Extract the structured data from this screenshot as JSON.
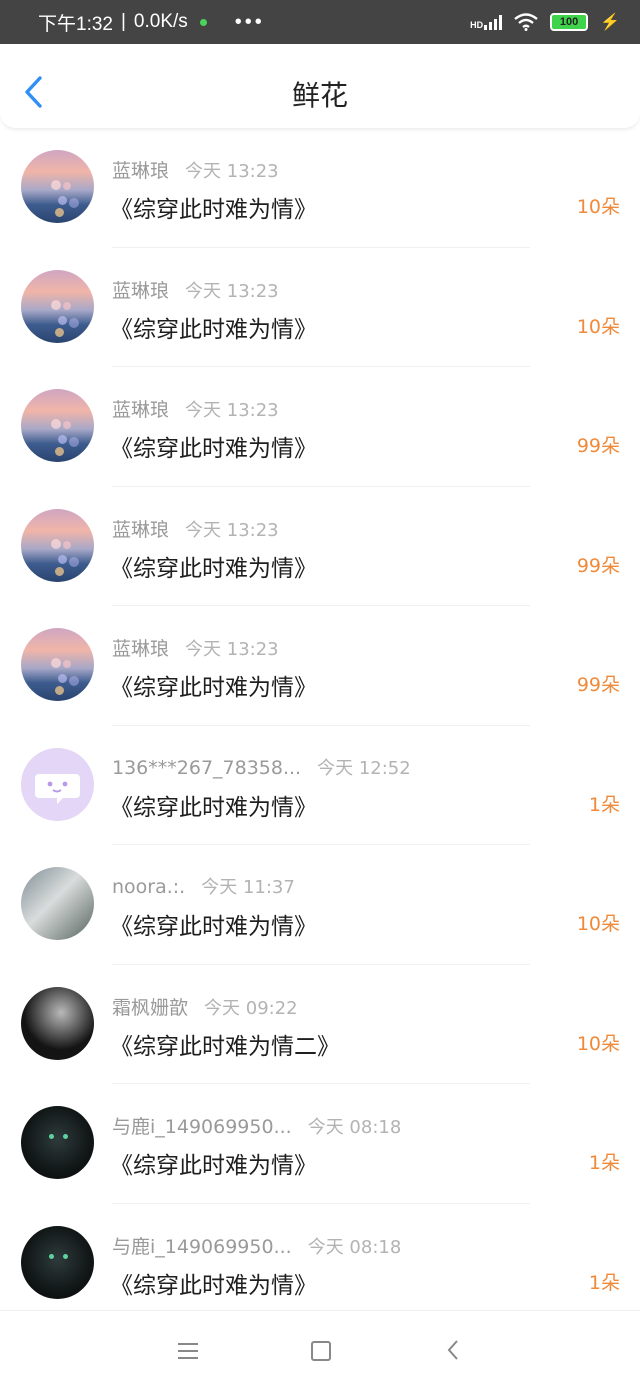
{
  "status_bar": {
    "time": "下午1:32",
    "speed": "0.0K/s",
    "separator": "|",
    "more": "•••",
    "network": "HD",
    "battery": "100"
  },
  "header": {
    "title": "鲜花"
  },
  "colors": {
    "accent_blue": "#2f8ff5",
    "flower_orange": "#f08a3b"
  },
  "records": [
    {
      "user": "蓝琳琅",
      "time": "今天 13:23",
      "book": "《综穿此时难为情》",
      "count": "10朵",
      "avatar": "sunset"
    },
    {
      "user": "蓝琳琅",
      "time": "今天 13:23",
      "book": "《综穿此时难为情》",
      "count": "10朵",
      "avatar": "sunset"
    },
    {
      "user": "蓝琳琅",
      "time": "今天 13:23",
      "book": "《综穿此时难为情》",
      "count": "99朵",
      "avatar": "sunset"
    },
    {
      "user": "蓝琳琅",
      "time": "今天 13:23",
      "book": "《综穿此时难为情》",
      "count": "99朵",
      "avatar": "sunset"
    },
    {
      "user": "蓝琳琅",
      "time": "今天 13:23",
      "book": "《综穿此时难为情》",
      "count": "99朵",
      "avatar": "sunset"
    },
    {
      "user": "136***267_78358...",
      "time": "今天 12:52",
      "book": "《综穿此时难为情》",
      "count": "1朵",
      "avatar": "default-purple"
    },
    {
      "user": "noora.:.",
      "time": "今天 11:37",
      "book": "《综穿此时难为情》",
      "count": "10朵",
      "avatar": "photo-mask"
    },
    {
      "user": "霜枫姗歆",
      "time": "今天 09:22",
      "book": "《综穿此时难为情二》",
      "count": "10朵",
      "avatar": "photo-costume"
    },
    {
      "user": "与鹿i_149069950...",
      "time": "今天 08:18",
      "book": "《综穿此时难为情》",
      "count": "1朵",
      "avatar": "dark"
    },
    {
      "user": "与鹿i_149069950...",
      "time": "今天 08:18",
      "book": "《综穿此时难为情》",
      "count": "1朵",
      "avatar": "dark"
    }
  ],
  "nav_bar": {
    "icons": [
      "menu-icon",
      "home-icon",
      "back-icon"
    ]
  }
}
